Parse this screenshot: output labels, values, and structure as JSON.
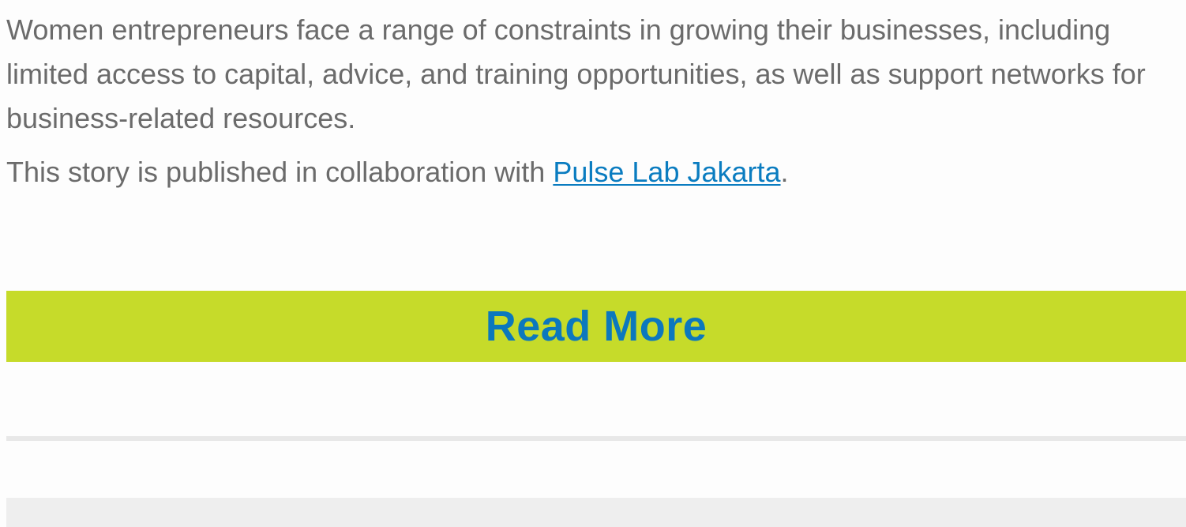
{
  "article": {
    "intro": "Women entrepreneurs face a range of constraints in growing their businesses, including limited access to capital, advice, and training opportunities, as well as support networks for business-related resources.",
    "credit_prefix": "This story is published in collaboration with ",
    "credit_link": "Pulse Lab Jakarta",
    "credit_suffix": "."
  },
  "cta": {
    "label": "Read More"
  },
  "colors": {
    "body_text": "#6b6b6b",
    "link": "#0a7cc0",
    "cta_background": "#c6db2a",
    "cta_text": "#0c78bd",
    "divider": "#e8e8e8",
    "footer_band": "#eeeeee"
  }
}
